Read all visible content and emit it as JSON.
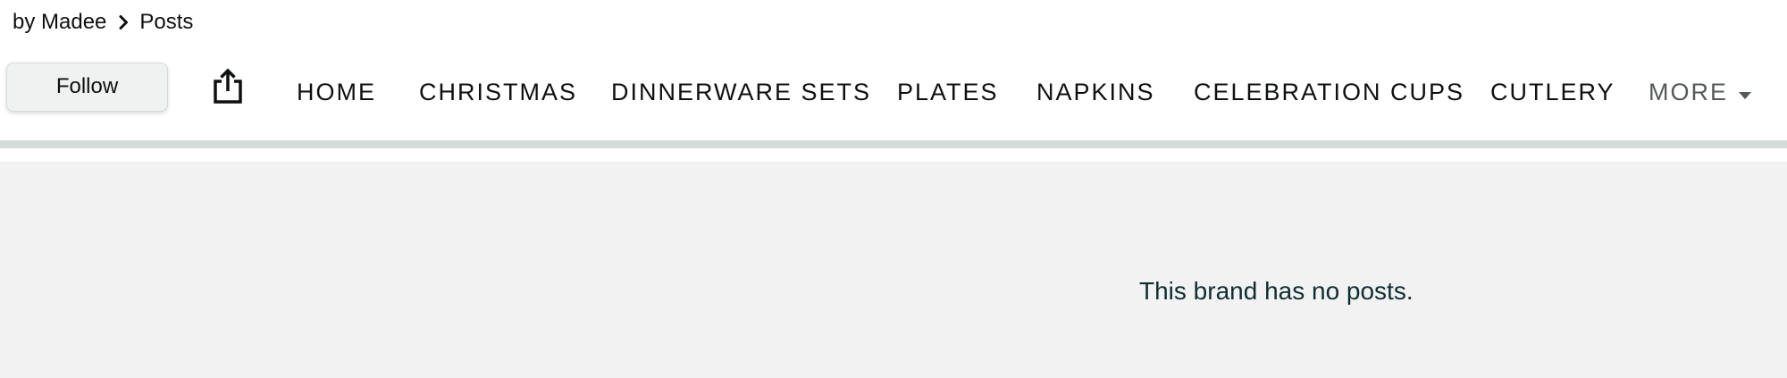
{
  "breadcrumb": {
    "brand": "by Madee",
    "current": "Posts"
  },
  "actions": {
    "follow_label": "Follow"
  },
  "nav": {
    "items": [
      "HOME",
      "CHRISTMAS",
      "DINNERWARE SETS",
      "PLATES",
      "NAPKINS",
      "CELEBRATION CUPS",
      "CUTLERY"
    ],
    "more_label": "MORE"
  },
  "content": {
    "empty_message": "This brand has no posts."
  },
  "colors": {
    "text": "#0f1111",
    "muted": "#565959",
    "message": "#0e2e33",
    "divider": "#d5dbdb",
    "content_bg": "#f2f2f2",
    "button_bg": "#f0f2f2"
  },
  "icons": {
    "breadcrumb_sep": "chevron-right-icon",
    "share": "share-icon",
    "more": "caret-down-icon"
  }
}
